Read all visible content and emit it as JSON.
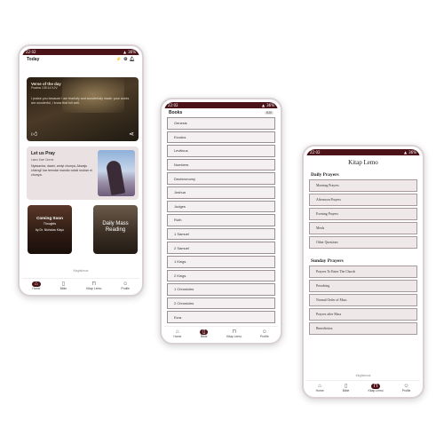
{
  "colors": {
    "accent": "#4b1218",
    "row_bg": "#f4eff0",
    "card_bg": "#e9e1e2"
  },
  "status": {
    "time": "22:02",
    "battery": "36%"
  },
  "phone1": {
    "header_title": "Today",
    "verse": {
      "title": "Verse of the day",
      "ref": "Psalms 139:14 KJV",
      "text": "I praise you because I am fearfully and wonderfully made; your works are wonderful, I know that full well.",
      "like_icon": "thumbs-up-icon",
      "share_icon": "share-icon"
    },
    "pray": {
      "title": "Let us Pray",
      "sub": "Lamu Kwe Ocene",
      "text": "Nyasacha, daani, amiyi chunya, Akwaju chiengi' kar teendai mandio odoki mokan ni chunya."
    },
    "tile_a": {
      "line1": "Coming Soon",
      "line2": "Thoughts",
      "line3": "by Dr. Nicholas Kisyo"
    },
    "tile_b": {
      "line1": "Daily Mass Reading"
    },
    "footer": "Kingfishroot"
  },
  "phone2": {
    "header_title": "Books",
    "badge": "KJV",
    "books": [
      "Genesis",
      "Exodus",
      "Leviticus",
      "Numbers",
      "Deuteronomy",
      "Joshua",
      "Judges",
      "Ruth",
      "1 Samuel",
      "2 Samuel",
      "1 Kings",
      "2 Kings",
      "1 Chronicles",
      "2 Chronicles",
      "Ezra"
    ]
  },
  "phone3": {
    "title": "Kitap Lemo",
    "section1": "Daily Prayers",
    "daily": [
      "Morning Prayers",
      "Afternoon Prayers",
      "Evening Prayers",
      "Meals",
      "Other Questions"
    ],
    "section2": "Sunday Prayers",
    "sunday": [
      "Prayers To Enter The Church",
      "Preaching",
      "Normal Order of Mass",
      "Prayers after Mass",
      "Benediction"
    ],
    "footer": "Kingfishroot"
  },
  "nav": {
    "home": "Home",
    "bible": "Bible",
    "kitap": "Kitap Lemo",
    "profile": "Profile"
  }
}
